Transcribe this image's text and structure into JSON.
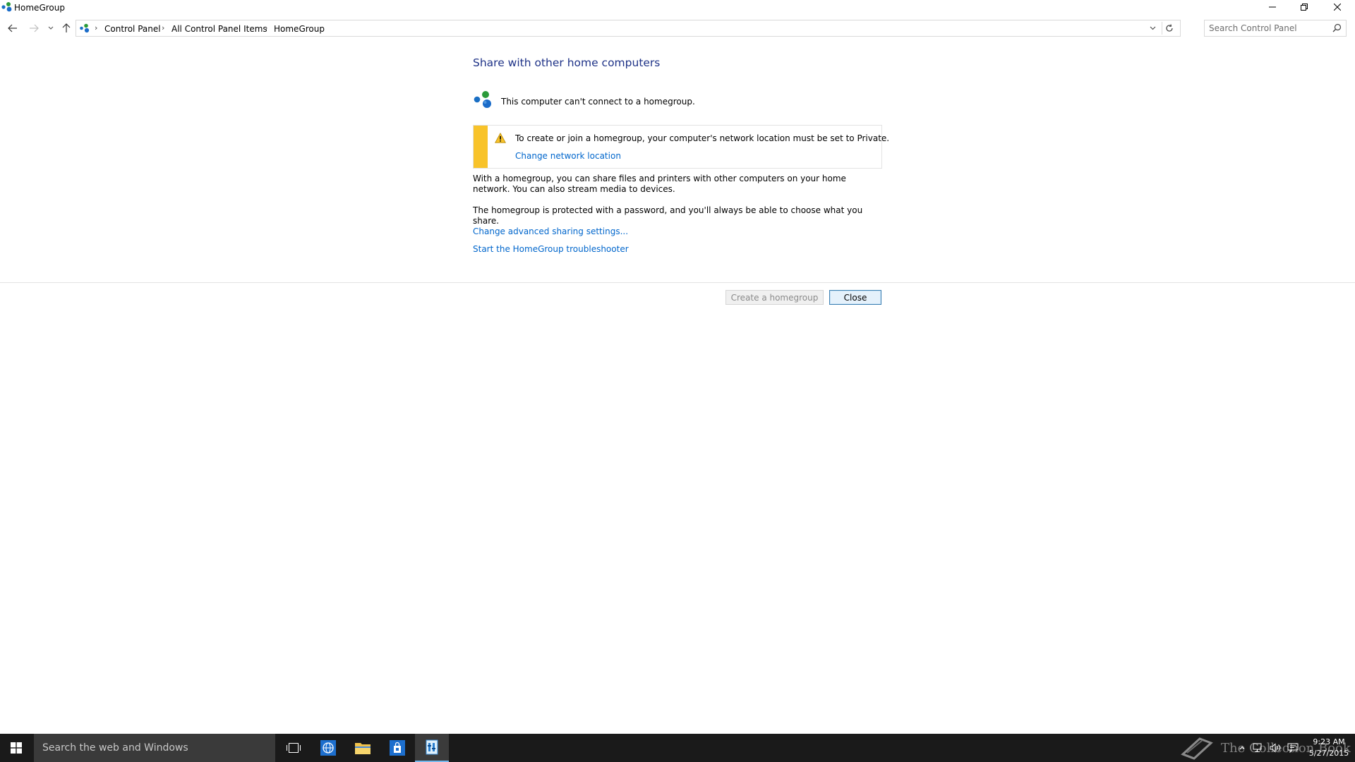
{
  "window": {
    "title": "HomeGroup"
  },
  "nav": {
    "breadcrumb": [
      "Control Panel",
      "All Control Panel Items",
      "HomeGroup"
    ],
    "search_placeholder": "Search Control Panel"
  },
  "main": {
    "heading": "Share with other home computers",
    "status_text": "This computer can't connect to a homegroup.",
    "warning": {
      "text": "To create or join a homegroup, your computer's network location must be set to Private.",
      "link": "Change network location",
      "accent_color": "#f8c32a"
    },
    "paragraphs": [
      "With a homegroup, you can share files and printers with other computers on your home network. You can also stream media to devices.",
      "The homegroup is protected with a password, and you'll always be able to choose what you share."
    ],
    "links": [
      "Change advanced sharing settings...",
      "Start the HomeGroup troubleshooter"
    ],
    "buttons": {
      "create": "Create a homegroup",
      "close": "Close"
    }
  },
  "taskbar": {
    "search_placeholder": "Search the web and Windows",
    "watermark": "The Collection Book",
    "time": "9:23 AM",
    "date": "5/27/2015"
  },
  "colors": {
    "link": "#0066cc",
    "heading": "#1e3287",
    "taskbar": "#1a1a1a"
  }
}
